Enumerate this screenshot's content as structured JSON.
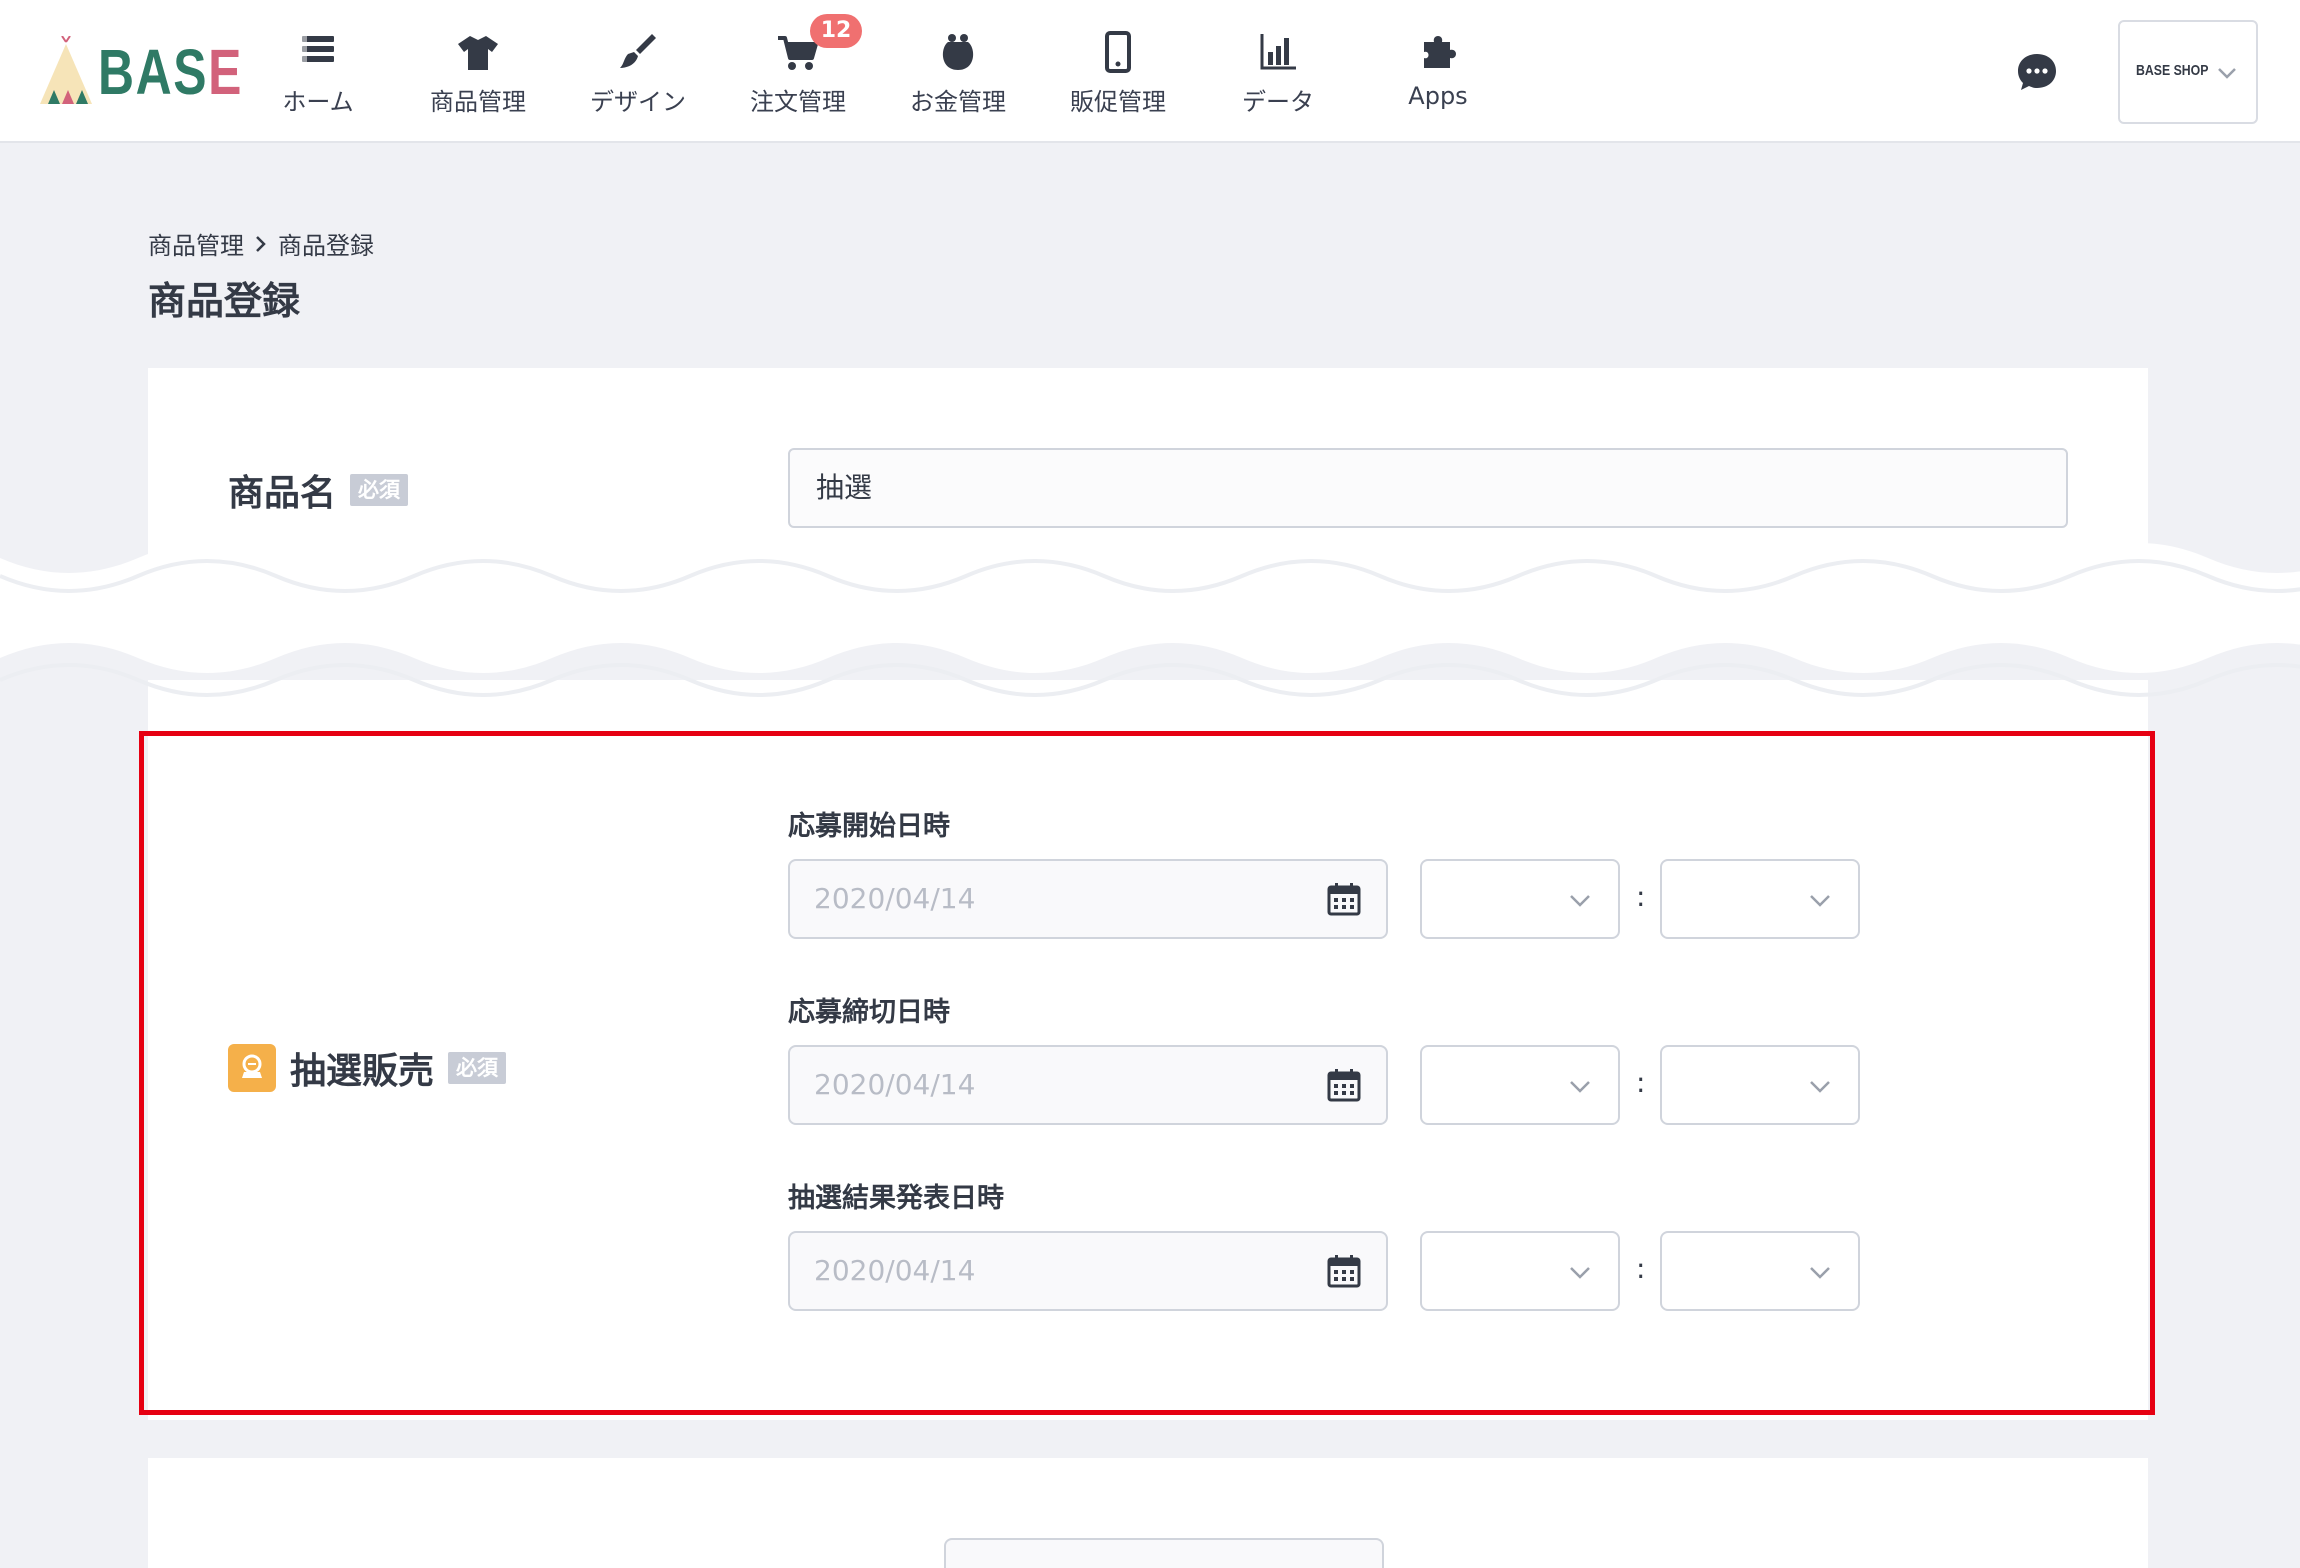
{
  "app": {
    "logo_text_main": "BAS",
    "logo_text_accent": "E"
  },
  "nav": {
    "items": [
      {
        "label": "ホーム",
        "icon": "home-list-icon"
      },
      {
        "label": "商品管理",
        "icon": "tshirt-icon"
      },
      {
        "label": "デザイン",
        "icon": "paintbrush-icon"
      },
      {
        "label": "注文管理",
        "icon": "cart-icon",
        "badge": "12"
      },
      {
        "label": "お金管理",
        "icon": "money-purse-icon"
      },
      {
        "label": "販促管理",
        "icon": "smartphone-icon"
      },
      {
        "label": "データ",
        "icon": "bar-chart-icon"
      },
      {
        "label": "Apps",
        "icon": "puzzle-icon"
      }
    ],
    "shop_name": "BASE SHOP"
  },
  "breadcrumb": {
    "parent": "商品管理",
    "current": "商品登録"
  },
  "page": {
    "title": "商品登録"
  },
  "form": {
    "product_name": {
      "label": "商品名",
      "required": "必須",
      "value": "抽選"
    },
    "lottery": {
      "label": "抽選販売",
      "required": "必須",
      "start": {
        "label": "応募開始日時",
        "date": "2020/04/14"
      },
      "end": {
        "label": "応募締切日時",
        "date": "2020/04/14"
      },
      "result": {
        "label": "抽選結果発表日時",
        "date": "2020/04/14"
      },
      "time_separator": ":"
    }
  },
  "colors": {
    "accent": "#e60012",
    "badge": "#f07070",
    "lottery_icon": "#f5b04a",
    "logo_green": "#2f7a65",
    "logo_pink": "#d2627b"
  }
}
